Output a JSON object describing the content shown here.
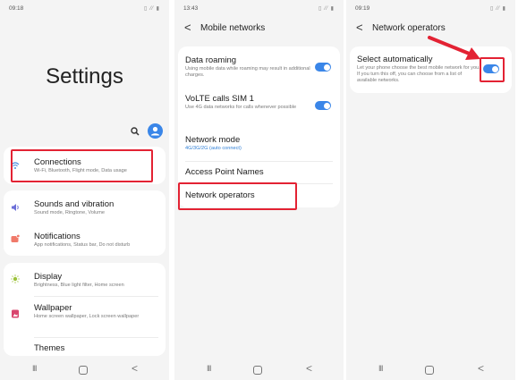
{
  "screen1": {
    "status_time": "09:18",
    "status_icons": "▯ ⁄⁄ ▮",
    "title": "Settings",
    "items": [
      {
        "label": "Connections",
        "sub": "Wi-Fi, Bluetooth, Flight mode, Data usage"
      },
      {
        "label": "Sounds and vibration",
        "sub": "Sound mode, Ringtone, Volume"
      },
      {
        "label": "Notifications",
        "sub": "App notifications, Status bar, Do not disturb"
      },
      {
        "label": "Display",
        "sub": "Brightness, Blue light filter, Home screen"
      },
      {
        "label": "Wallpaper",
        "sub": "Home screen wallpaper, Lock screen wallpaper"
      },
      {
        "label": "Themes",
        "sub": ""
      }
    ]
  },
  "screen2": {
    "status_time": "13:43",
    "status_icons": "▯ ⁄⁄ ▮",
    "back": "<",
    "title": "Mobile networks",
    "items": [
      {
        "label": "Data roaming",
        "sub": "Using mobile data while roaming may result in additional charges.",
        "toggle": true
      },
      {
        "label": "VoLTE calls SIM 1",
        "sub": "Use 4G data networks for calls whenever possible",
        "toggle": true
      },
      {
        "label": "Network mode",
        "sub": "4G/3G/2G (auto connect)",
        "toggle": false
      },
      {
        "label": "Access Point Names",
        "sub": "",
        "toggle": false
      },
      {
        "label": "Network operators",
        "sub": "",
        "toggle": false
      }
    ]
  },
  "screen3": {
    "status_time": "09:19",
    "status_icons": "▯ ⁄⁄ ▮",
    "back": "<",
    "title": "Network operators",
    "item": {
      "label": "Select automatically",
      "sub": "Let your phone choose the best mobile network for you. If you turn this off, you can choose from a list of available networks.",
      "toggle": true
    }
  },
  "nav": {
    "recent": "III",
    "back": "<"
  },
  "colors": {
    "accent": "#3a86e8",
    "highlight": "#e32233",
    "link": "#2f7fd6"
  }
}
